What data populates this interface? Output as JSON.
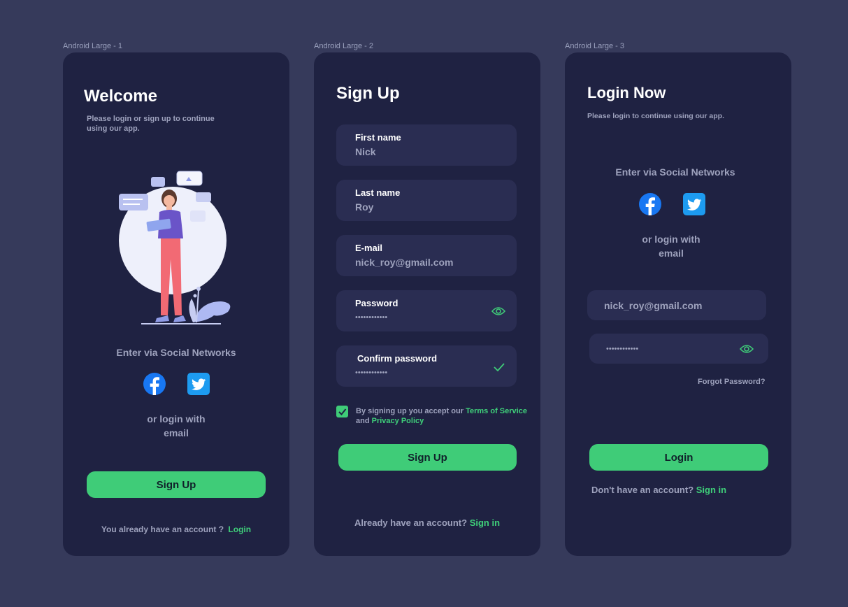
{
  "colors": {
    "background": "#363a5b",
    "frame": "#1f2242",
    "field": "#2a2d52",
    "accent": "#3fcc78",
    "muted": "#9ea2bd"
  },
  "frames": [
    {
      "label": "Android Large - 1",
      "title": "Welcome",
      "subtitle_line1": "Please login or sign up to continue",
      "subtitle_line2": "using our app.",
      "social_heading": "Enter via Social Networks",
      "or_line1": "or login with",
      "or_line2": "email",
      "button": "Sign Up",
      "footer_text": "You already have an account ?",
      "footer_link": "Login"
    },
    {
      "label": "Android Large - 2",
      "title": "Sign Up",
      "fields": [
        {
          "label": "First name",
          "value": "Nick"
        },
        {
          "label": "Last name",
          "value": "Roy"
        },
        {
          "label": "E-mail",
          "value": "nick_roy@gmail.com"
        },
        {
          "label": "Password",
          "value": "••••••••••••"
        },
        {
          "label": "Confirm password",
          "value": "••••••••••••"
        }
      ],
      "terms_prefix": "By signing up you accept our",
      "terms_link": "Terms of Service",
      "terms_and": "and",
      "privacy_link": "Privacy Policy",
      "button": "Sign Up",
      "footer_text": "Already have an account?",
      "footer_link": "Sign in"
    },
    {
      "label": "Android Large - 3",
      "title": "Login Now",
      "subtitle": "Please login to continue using our app.",
      "social_heading": "Enter via Social Networks",
      "or_line1": "or login with",
      "or_line2": "email",
      "email_value": "nick_roy@gmail.com",
      "password_value": "••••••••••••",
      "forgot": "Forgot Password?",
      "button": "Login",
      "footer_text": "Don't have an account?",
      "footer_link": "Sign in"
    }
  ]
}
